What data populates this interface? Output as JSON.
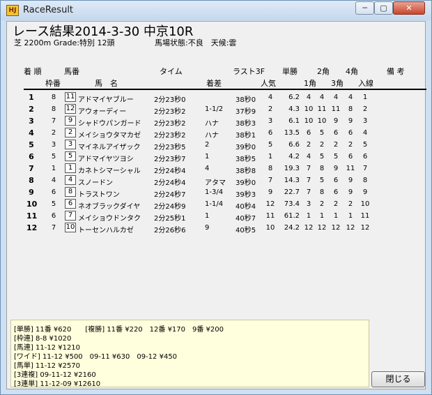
{
  "window": {
    "title": "RaceResult",
    "app_icon": "HJ",
    "minimize_glyph": "─",
    "maximize_glyph": "▢",
    "close_glyph": "✕"
  },
  "race": {
    "title": "レース結果2014-3-30 中京10R",
    "info": "芝 2200m Grade:特別 12頭",
    "condition": "馬場状態:不良　天候:雲"
  },
  "headers": {
    "chaku": "着 順",
    "umaban": "馬番",
    "time": "タイム",
    "last3f": "ラスト3F",
    "tansho": "単勝",
    "kaku2": "2角",
    "kaku4": "4角",
    "biko": "備 考",
    "waku": "枠番",
    "name": "馬　名",
    "margin": "着差",
    "popularity": "人気",
    "kaku1": "1角",
    "kaku3": "3角",
    "nyusen": "入線"
  },
  "rows": [
    {
      "chaku": "1",
      "waku": "8",
      "umaban": "11",
      "name": "アドマイヤブルー",
      "time": "2分23秒0",
      "margin": "",
      "last3f": "38秒0",
      "pop": "4",
      "odds": "6.2",
      "k1": "4",
      "k2": "4",
      "k3": "4",
      "k4": "4",
      "nyusen": "1"
    },
    {
      "chaku": "2",
      "waku": "8",
      "umaban": "12",
      "name": "アウォーディー",
      "time": "2分23秒2",
      "margin": "1-1/2",
      "last3f": "37秒9",
      "pop": "2",
      "odds": "4.3",
      "k1": "10",
      "k2": "11",
      "k3": "11",
      "k4": "8",
      "nyusen": "2"
    },
    {
      "chaku": "3",
      "waku": "7",
      "umaban": "9",
      "name": "シャドウパンガード",
      "time": "2分23秒2",
      "margin": "ハナ",
      "last3f": "38秒3",
      "pop": "3",
      "odds": "6.1",
      "k1": "10",
      "k2": "10",
      "k3": "9",
      "k4": "9",
      "nyusen": "3"
    },
    {
      "chaku": "4",
      "waku": "2",
      "umaban": "2",
      "name": "メイショウタマカゼ",
      "time": "2分23秒2",
      "margin": "ハナ",
      "last3f": "38秒1",
      "pop": "6",
      "odds": "13.5",
      "k1": "6",
      "k2": "5",
      "k3": "6",
      "k4": "6",
      "nyusen": "4"
    },
    {
      "chaku": "5",
      "waku": "3",
      "umaban": "3",
      "name": "マイネルアイザック",
      "time": "2分23秒5",
      "margin": "2",
      "last3f": "39秒0",
      "pop": "5",
      "odds": "6.6",
      "k1": "2",
      "k2": "2",
      "k3": "2",
      "k4": "2",
      "nyusen": "5"
    },
    {
      "chaku": "6",
      "waku": "5",
      "umaban": "5",
      "name": "アドマイヤツヨシ",
      "time": "2分23秒7",
      "margin": "1",
      "last3f": "38秒5",
      "pop": "1",
      "odds": "4.2",
      "k1": "4",
      "k2": "5",
      "k3": "5",
      "k4": "6",
      "nyusen": "6"
    },
    {
      "chaku": "7",
      "waku": "1",
      "umaban": "1",
      "name": "カネトシマーシャル",
      "time": "2分24秒4",
      "margin": "4",
      "last3f": "38秒8",
      "pop": "8",
      "odds": "19.3",
      "k1": "7",
      "k2": "8",
      "k3": "9",
      "k4": "11",
      "nyusen": "7"
    },
    {
      "chaku": "8",
      "waku": "4",
      "umaban": "4",
      "name": "スノードン",
      "time": "2分24秒4",
      "margin": "アタマ",
      "last3f": "39秒0",
      "pop": "7",
      "odds": "14.3",
      "k1": "7",
      "k2": "5",
      "k3": "6",
      "k4": "9",
      "nyusen": "8"
    },
    {
      "chaku": "9",
      "waku": "6",
      "umaban": "8",
      "name": "トラストワン",
      "time": "2分24秒7",
      "margin": "1-3/4",
      "last3f": "39秒3",
      "pop": "9",
      "odds": "22.7",
      "k1": "7",
      "k2": "8",
      "k3": "6",
      "k4": "9",
      "nyusen": "9"
    },
    {
      "chaku": "10",
      "waku": "5",
      "umaban": "6",
      "name": "ネオブラックダイヤ",
      "time": "2分24秒9",
      "margin": "1-1/4",
      "last3f": "40秒4",
      "pop": "12",
      "odds": "73.4",
      "k1": "3",
      "k2": "2",
      "k3": "2",
      "k4": "2",
      "nyusen": "10"
    },
    {
      "chaku": "11",
      "waku": "6",
      "umaban": "7",
      "name": "メイショウドンタク",
      "time": "2分25秒1",
      "margin": "1",
      "last3f": "40秒7",
      "pop": "11",
      "odds": "61.2",
      "k1": "1",
      "k2": "1",
      "k3": "1",
      "k4": "1",
      "nyusen": "11"
    },
    {
      "chaku": "12",
      "waku": "7",
      "umaban": "10",
      "name": "トーセンハルカゼ",
      "time": "2分26秒6",
      "margin": "9",
      "last3f": "40秒5",
      "pop": "10",
      "odds": "24.2",
      "k1": "12",
      "k2": "12",
      "k3": "12",
      "k4": "12",
      "nyusen": "12"
    }
  ],
  "payouts": [
    "[単勝] 11番 ¥620　　[複勝] 11番 ¥220　12番 ¥170　9番 ¥200",
    "[枠連] 8-8 ¥1020",
    "[馬連] 11-12 ¥1210",
    "[ワイド] 11-12 ¥500　09-11 ¥630　09-12 ¥450",
    "[馬単] 11-12 ¥2570",
    "[3連複] 09-11-12 ¥2160",
    "[3連単] 11-12-09 ¥12610"
  ],
  "close_button": "閉じる"
}
